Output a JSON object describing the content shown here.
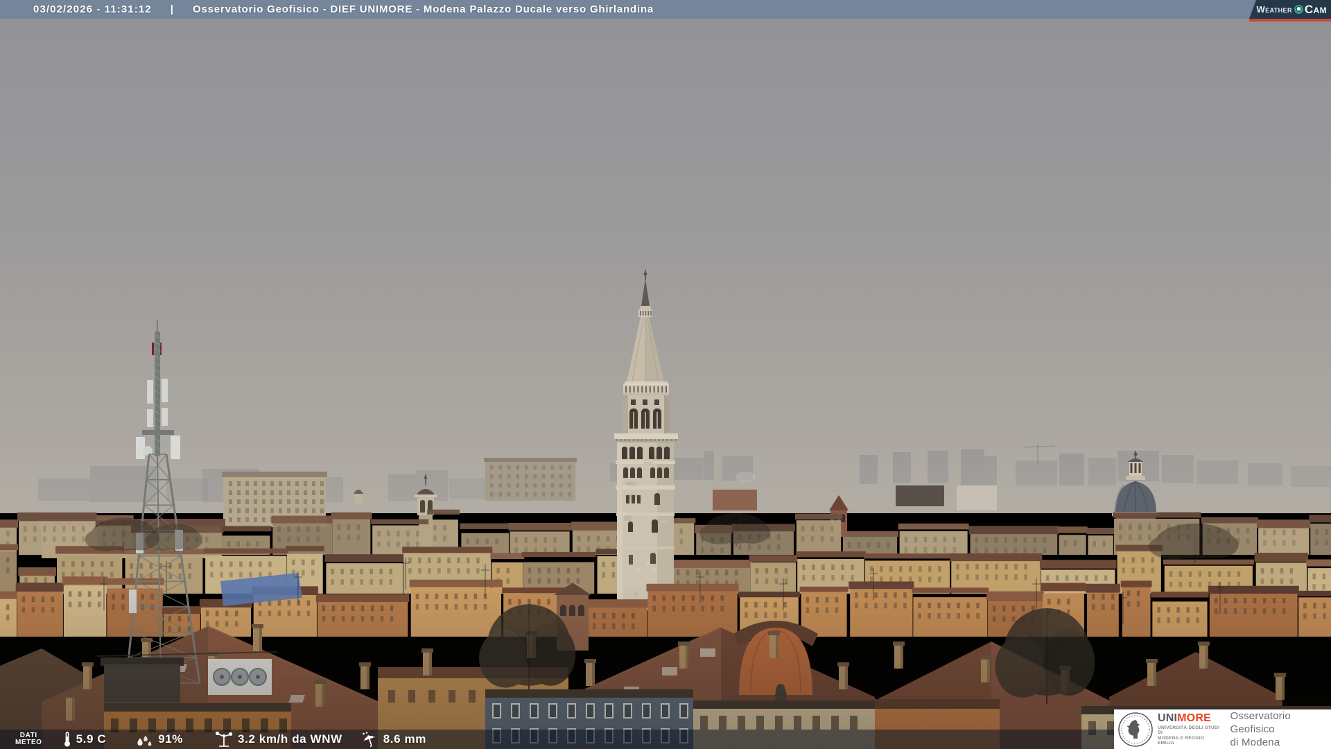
{
  "header": {
    "datetime": "03/02/2026 - 11:31:12",
    "separator": "|",
    "title": "Osservatorio Geofisico - DIEF UNIMORE - Modena Palazzo Ducale verso Ghirlandina"
  },
  "weathercam": {
    "weather": "Weather",
    "cam": "Cam"
  },
  "meteo": {
    "label1": "DATI",
    "label2": "METEO",
    "temperature": "5.9 C",
    "humidity": "91%",
    "wind": "3.2 km/h da WNW",
    "precipitation": "8.6 mm"
  },
  "unimore": {
    "uni": "UNI",
    "more": "MORE",
    "dept1": "UNIVERSITÀ DEGLI STUDI DI",
    "dept2": "MODENA E REGGIO EMILIA",
    "obs1": "Osservatorio Geofisico",
    "obs2": "di Modena"
  },
  "colors": {
    "top_bar": "#75869b",
    "overlay_bar": "rgba(12,20,32,0.52)",
    "logo_bg": "#24384a",
    "logo_accent": "#c74a33",
    "logo_lens": "#2fa093",
    "unimore_red": "#e8411f",
    "unimore_gray": "#58585a",
    "sky_top": "#929296",
    "sky_horizon": "#b1aca3"
  }
}
